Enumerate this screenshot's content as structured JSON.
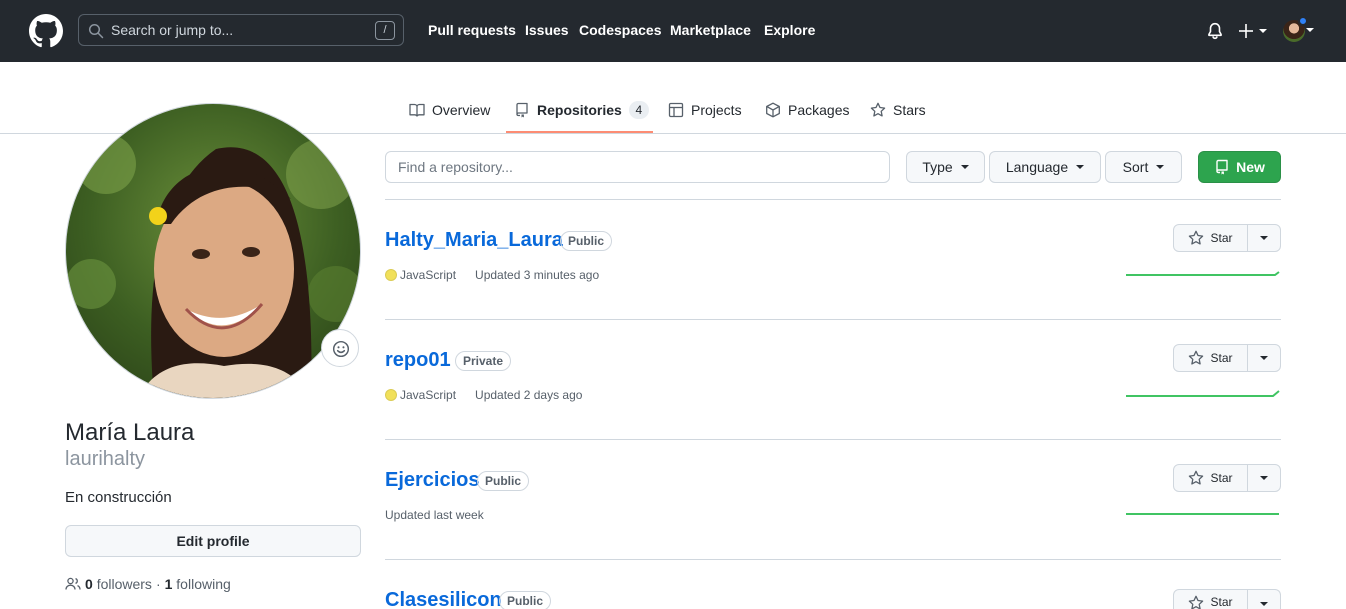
{
  "header": {
    "search_placeholder": "Search or jump to...",
    "search_shortcut": "/",
    "nav": [
      "Pull requests",
      "Issues",
      "Codespaces",
      "Marketplace",
      "Explore"
    ]
  },
  "tabs": [
    {
      "label": "Overview",
      "icon": "book-icon"
    },
    {
      "label": "Repositories",
      "icon": "repo-icon",
      "count": "4",
      "selected": true
    },
    {
      "label": "Projects",
      "icon": "table-icon"
    },
    {
      "label": "Packages",
      "icon": "package-icon"
    },
    {
      "label": "Stars",
      "icon": "star-icon"
    }
  ],
  "profile": {
    "name": "María Laura",
    "login": "laurihalty",
    "bio": "En construcción",
    "edit_label": "Edit profile",
    "followers_count": "0",
    "followers_label": "followers",
    "separator": "·",
    "following_count": "1",
    "following_label": "following"
  },
  "filters": {
    "find_placeholder": "Find a repository...",
    "type_label": "Type",
    "language_label": "Language",
    "sort_label": "Sort",
    "new_label": "New"
  },
  "repos": [
    {
      "name": "Halty_Maria_Laura",
      "visibility": "Public",
      "language": "JavaScript",
      "updated": "Updated 3 minutes ago",
      "star_label": "Star"
    },
    {
      "name": "repo01",
      "visibility": "Private",
      "language": "JavaScript",
      "updated": "Updated 2 days ago",
      "star_label": "Star"
    },
    {
      "name": "Ejercicios",
      "visibility": "Public",
      "language": "",
      "updated": "Updated last week",
      "star_label": "Star"
    },
    {
      "name": "Clasesilicon",
      "visibility": "Public",
      "language": "",
      "updated": "",
      "star_label": "Star"
    }
  ],
  "colors": {
    "header_bg": "#24292f",
    "link": "#0969da",
    "primary_button": "#2da44e",
    "tab_underline": "#fd8c73",
    "javascript": "#f1e05a",
    "sparkline": "#40c463"
  }
}
